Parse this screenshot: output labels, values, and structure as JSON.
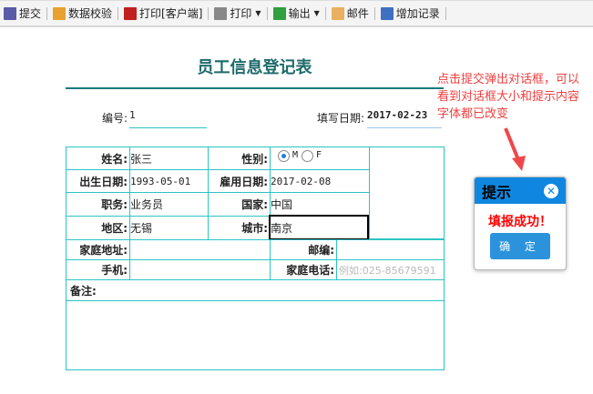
{
  "toolbar": {
    "items": [
      {
        "label": "提交",
        "color": "#5a5aa8"
      },
      {
        "label": "数据校验",
        "color": "#e8a030"
      },
      {
        "label": "打印[客户端]",
        "color": "#c02020"
      },
      {
        "label": "打印",
        "color": "#888888"
      },
      {
        "label": "输出",
        "color": "#30a040"
      },
      {
        "label": "邮件",
        "color": "#e8b060"
      },
      {
        "label": "增加记录",
        "color": "#4070c0"
      }
    ]
  },
  "form": {
    "title": "员工信息登记表",
    "id_label": "编号:",
    "id_value": "1",
    "date_label": "填写日期:",
    "date_value": "2017-02-23",
    "name_label": "姓名:",
    "name": "张三",
    "gender_label": "性别:",
    "gender_m": "M",
    "gender_f": "F",
    "birth_label": "出生日期:",
    "birth": "1993-05-01",
    "hire_label": "雇用日期:",
    "hire": "2017-02-08",
    "job_label": "职务:",
    "job": "业务员",
    "country_label": "国家:",
    "country": "中国",
    "region_label": "地区:",
    "region": "无锡",
    "city_label": "城市:",
    "city": "南京",
    "address_label": "家庭地址:",
    "zip_label": "邮编:",
    "mobile_label": "手机:",
    "phone_label": "家庭电话:",
    "phone_placeholder": "例如:025-85679591",
    "remark_label": "备注:"
  },
  "annotation": "点击提交弹出对话框，可以看到对话框大小和提示内容字体都已改变",
  "dialog": {
    "title": "提示",
    "message": "填报成功！",
    "ok": "确 定"
  }
}
